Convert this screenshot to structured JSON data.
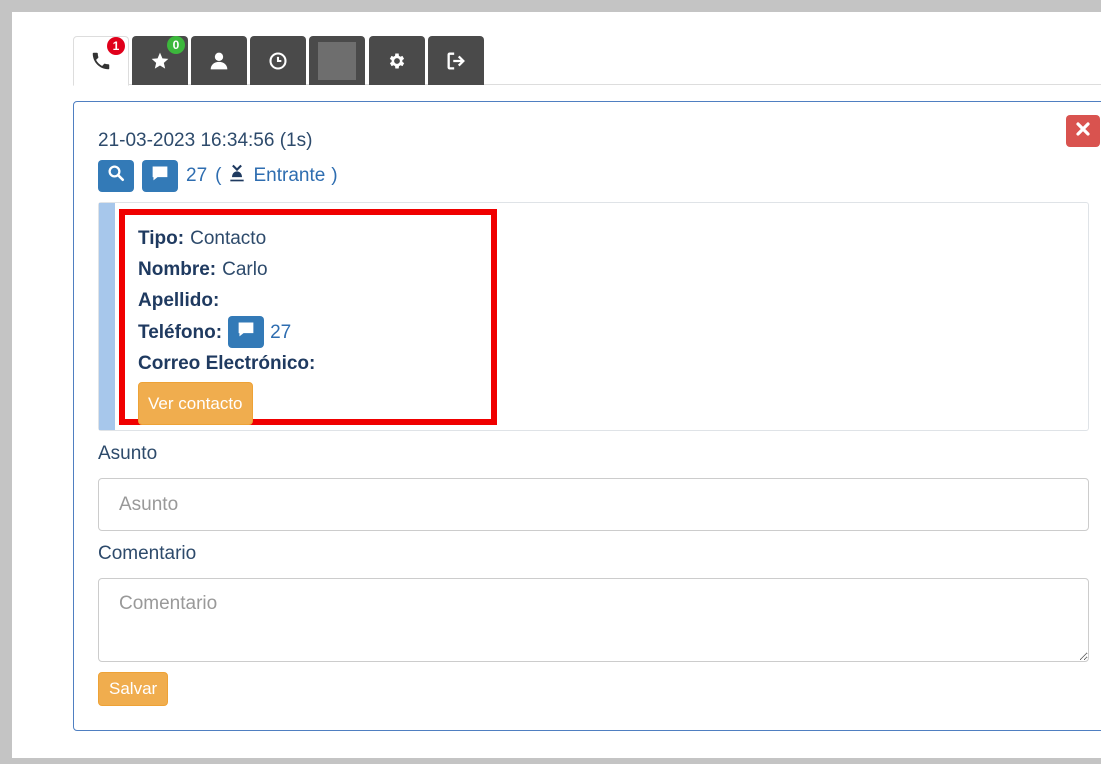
{
  "tabs": [
    {
      "name": "calls",
      "icon": "phone-icon",
      "badge": "1",
      "badge_color": "#e0001b",
      "active": true
    },
    {
      "name": "favorites",
      "icon": "star-icon",
      "badge": "0",
      "badge_color": "#3cb83c"
    },
    {
      "name": "contacts",
      "icon": "user-icon"
    },
    {
      "name": "history",
      "icon": "clock-icon"
    },
    {
      "name": "blank",
      "icon": "gray-square-icon"
    },
    {
      "name": "settings",
      "icon": "gear-icon"
    },
    {
      "name": "logout",
      "icon": "logout-icon"
    }
  ],
  "call": {
    "datetime": "21-03-2023 16:34:56 (1s)",
    "number": "27",
    "open_paren": "(",
    "direction": "Entrante",
    "close_paren": ")"
  },
  "contact": {
    "tipo_label": "Tipo:",
    "tipo_value": "Contacto",
    "nombre_label": "Nombre:",
    "nombre_value": "Carlo",
    "apellido_label": "Apellido:",
    "apellido_value": "",
    "telefono_label": "Teléfono:",
    "telefono_value": "27",
    "correo_label": "Correo Electrónico:",
    "correo_value": "",
    "view_button": "Ver contacto"
  },
  "form": {
    "asunto_label": "Asunto",
    "asunto_placeholder": "Asunto",
    "comentario_label": "Comentario",
    "comentario_placeholder": "Comentario",
    "save_button": "Salvar"
  },
  "colors": {
    "primary": "#337ab7",
    "warning": "#f0ad4e",
    "danger": "#d9534f",
    "highlight": "#f00000"
  }
}
